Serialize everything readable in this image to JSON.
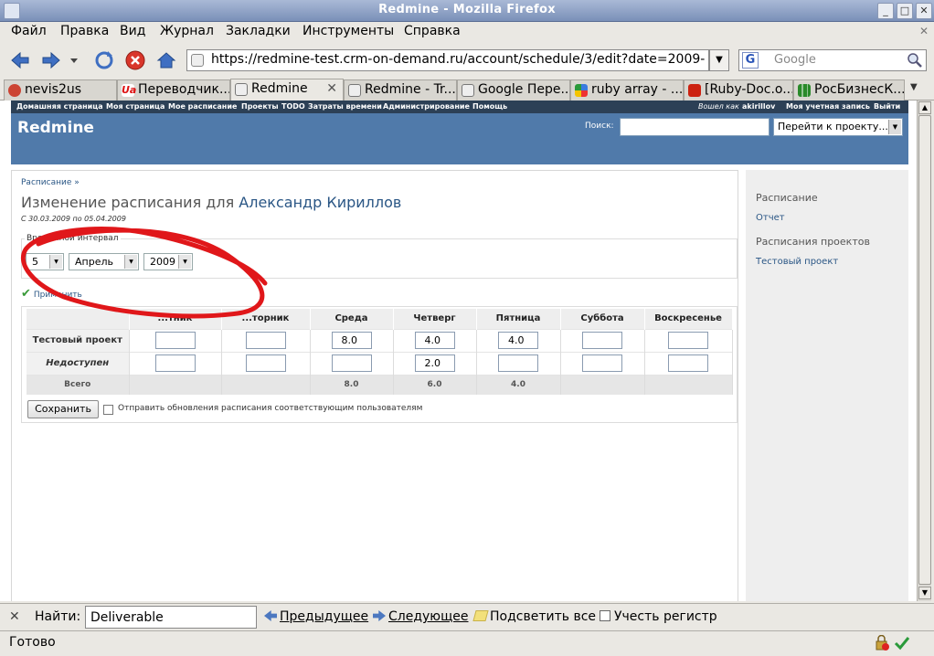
{
  "window": {
    "title": "Redmine - Mozilla Firefox"
  },
  "menu": [
    "Файл",
    "Правка",
    "Вид",
    "Журнал",
    "Закладки",
    "Инструменты",
    "Справка"
  ],
  "navbar": {
    "url": "https://redmine-test.crm-on-demand.ru/account/schedule/3/edit?date=2009-04-0",
    "search_placeholder": "Google",
    "search_engine_letter": "G"
  },
  "tabs": [
    {
      "label": "nevis2us",
      "active": false
    },
    {
      "label": "Переводчик...",
      "active": false
    },
    {
      "label": "Redmine",
      "active": true
    },
    {
      "label": "Redmine - Tr...",
      "active": false
    },
    {
      "label": "Google Пере...",
      "active": false
    },
    {
      "label": "ruby array - ...",
      "active": false
    },
    {
      "label": "[Ruby-Doc.o...",
      "active": false
    },
    {
      "label": "РосБизнесК...",
      "active": false
    }
  ],
  "redmine": {
    "top_menu": [
      "Домашняя страница",
      "Моя страница",
      "Мое расписание",
      "Проекты",
      "TODO",
      "Затраты времени",
      "Администрирование",
      "Помощь"
    ],
    "logged_in_label": "Вошел как",
    "logged_in_user": "akirillov",
    "account_link": "Моя учетная запись",
    "logout_link": "Выйти",
    "logo": "Redmine",
    "search_label": "Поиск:",
    "jump_select": "Перейти к проекту..."
  },
  "content": {
    "breadcrumb": "Расписание »",
    "title_prefix": "Изменение расписания для",
    "title_user": "Александр Кириллов",
    "date_range": "С 30.03.2009 по 05.04.2009",
    "interval_legend": "Временной интервал",
    "day": "5",
    "month": "Апрель",
    "year": "2009",
    "apply": "Применить",
    "headers": [
      "",
      "...тник",
      "...торник",
      "Среда",
      "Четверг",
      "Пятница",
      "Суббота",
      "Воскресенье"
    ],
    "rows": [
      {
        "label": "Тестовый проект",
        "values": [
          "",
          "",
          "8.0",
          "4.0",
          "4.0",
          "",
          ""
        ]
      },
      {
        "label": "Недоступен",
        "values": [
          "",
          "",
          "",
          "2.0",
          "",
          "",
          ""
        ]
      }
    ],
    "totals": {
      "label": "Всего",
      "values": [
        "",
        "",
        "8.0",
        "6.0",
        "4.0",
        "",
        ""
      ]
    },
    "save_button": "Сохранить",
    "notify_label": "Отправить обновления расписания соответствующим пользователям"
  },
  "sidebar": {
    "schedule_heading": "Расписание",
    "report_link": "Отчет",
    "projects_heading": "Расписания проектов",
    "project_link": "Тестовый проект"
  },
  "findbar": {
    "label": "Найти:",
    "value": "Deliverable",
    "prev": "Предыдущее",
    "next": "Следующее",
    "highlight": "Подсветить все",
    "match_case": "Учесть регистр"
  },
  "status": {
    "text": "Готово"
  },
  "colors": {
    "header_blue": "#507aaa",
    "topmenu_dark": "#2c4056",
    "link": "#2a5685",
    "annotation_red": "#e0171a"
  }
}
